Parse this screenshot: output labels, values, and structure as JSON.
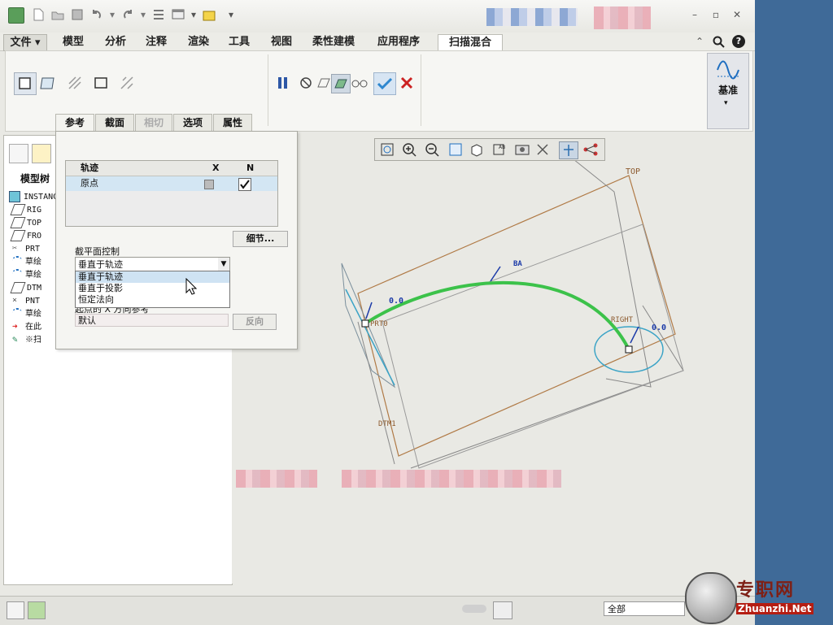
{
  "menu": {
    "tabs": [
      "文件 ▾",
      "模型",
      "分析",
      "注释",
      "渲染",
      "工具",
      "视图",
      "柔性建模",
      "应用程序",
      "扫描混合"
    ],
    "active_tab": "扫描混合"
  },
  "ribbon": {
    "datum_label": "基准"
  },
  "dashboard_tabs": [
    "参考",
    "截面",
    "相切",
    "选项",
    "属性"
  ],
  "panel": {
    "table_header_trajectory": "轨迹",
    "table_header_x": "X",
    "table_header_n": "N",
    "table_row_name": "原点",
    "details_button": "细节...",
    "section_plane_label": "截平面控制",
    "dropdown_value": "垂直于轨迹",
    "dropdown_options": [
      "垂直于轨迹",
      "垂直于投影",
      "恒定法向"
    ],
    "x_ref_label": "起点的 X 方向参考",
    "x_ref_value": "默认",
    "flip_button": "反向"
  },
  "model_tree": {
    "title": "模型树",
    "items": [
      "INSTANC",
      "RIG",
      "TOP",
      "FRO",
      "PRT",
      "草绘",
      "草绘",
      "DTM",
      "PNT",
      "草绘",
      "在此",
      "※扫"
    ]
  },
  "viewport": {
    "labels": {
      "top": "TOP",
      "prt": "PRT0",
      "right": "RIGHT",
      "dtm": "DTM1",
      "dim1": "0.0",
      "dim2": "0.0",
      "dim3": "BA"
    }
  },
  "status": {
    "filter_value": "全部"
  },
  "watermark": {
    "text": "专职网",
    "url": "Zhuanzhi.Net"
  },
  "colors": {
    "trajectory": "#3cc24a",
    "datum": "#b07a46",
    "section": "#3aa3c6",
    "desktop": "#3f6a98"
  }
}
